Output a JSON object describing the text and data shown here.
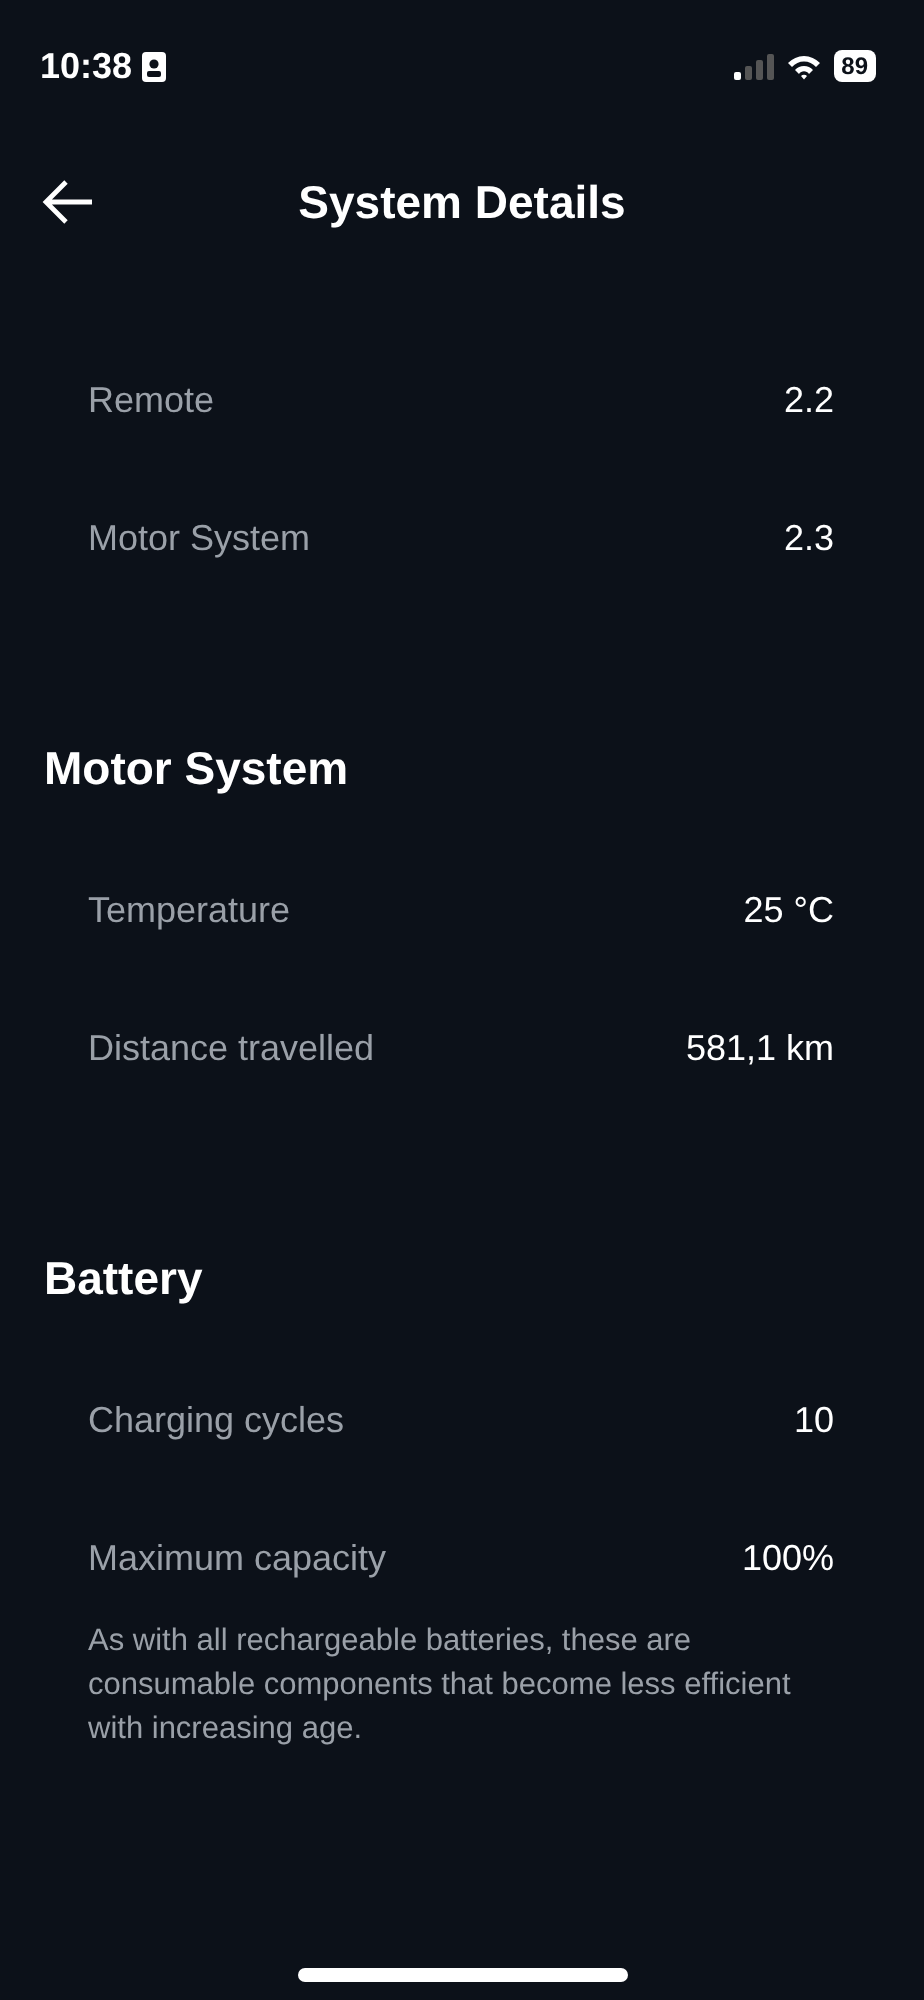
{
  "status_bar": {
    "time": "10:38",
    "battery": "89"
  },
  "header": {
    "title": "System Details"
  },
  "sections": [
    {
      "rows": [
        {
          "label": "Remote",
          "value": "2.2"
        },
        {
          "label": "Motor System",
          "value": "2.3"
        }
      ]
    },
    {
      "title": "Motor System",
      "rows": [
        {
          "label": "Temperature",
          "value": "25 °C"
        },
        {
          "label": "Distance travelled",
          "value": "581,1 km"
        }
      ]
    },
    {
      "title": "Battery",
      "rows": [
        {
          "label": "Charging cycles",
          "value": "10"
        },
        {
          "label": "Maximum capacity",
          "value": "100%"
        }
      ],
      "note": "As with all rechargeable batteries, these are consumable components that become less efficient with increasing age."
    }
  ]
}
